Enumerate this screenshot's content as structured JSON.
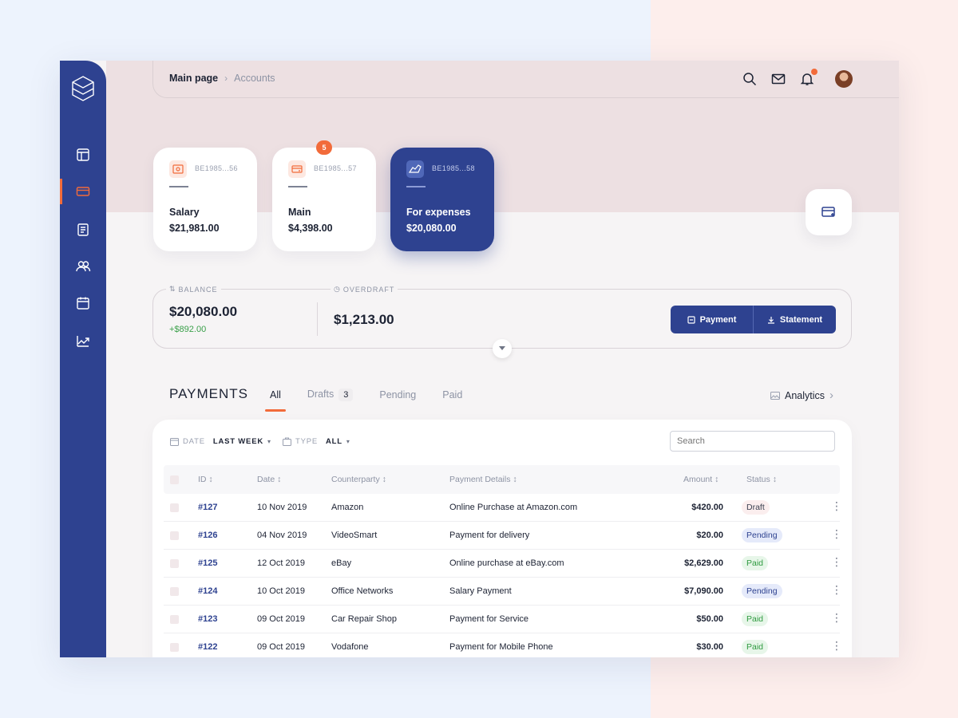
{
  "breadcrumb": {
    "current": "Main page",
    "last": "Accounts"
  },
  "notifications": {
    "has_unread": true
  },
  "accounts": [
    {
      "number": "BE1985...56",
      "name": "Salary",
      "amount": "$21,981.00"
    },
    {
      "number": "BE1985...57",
      "name": "Main",
      "amount": "$4,398.00",
      "badge": "5"
    },
    {
      "number": "BE1985...58",
      "name": "For expenses",
      "amount": "$20,080.00"
    }
  ],
  "balance": {
    "label": "BALANCE",
    "amount": "$20,080.00",
    "change": "+$892.00"
  },
  "overdraft": {
    "label": "OVERDRAFT",
    "amount": "$1,213.00"
  },
  "actions": {
    "payment": "Payment",
    "statement": "Statement"
  },
  "payments": {
    "title": "PAYMENTS",
    "tabs": [
      {
        "label": "All"
      },
      {
        "label": "Drafts",
        "count": "3"
      },
      {
        "label": "Pending"
      },
      {
        "label": "Paid"
      }
    ],
    "analytics": "Analytics"
  },
  "filters": {
    "date_label": "DATE",
    "date_value": "LAST WEEK",
    "type_label": "TYPE",
    "type_value": "ALL",
    "search_placeholder": "Search"
  },
  "table": {
    "columns": [
      "ID",
      "Date",
      "Counterparty",
      "Payment Details",
      "Amount",
      "Status"
    ],
    "rows": [
      {
        "id": "#127",
        "date": "10 Nov 2019",
        "counterparty": "Amazon",
        "details": "Online Purchase at Amazon.com",
        "amount": "$420.00",
        "status": "Draft"
      },
      {
        "id": "#126",
        "date": "04 Nov 2019",
        "counterparty": "VideoSmart",
        "details": "Payment for delivery",
        "amount": "$20.00",
        "status": "Pending"
      },
      {
        "id": "#125",
        "date": "12 Oct 2019",
        "counterparty": "eBay",
        "details": "Online purchase at eBay.com",
        "amount": "$2,629.00",
        "status": "Paid"
      },
      {
        "id": "#124",
        "date": "10 Oct 2019",
        "counterparty": "Office Networks",
        "details": "Salary Payment",
        "amount": "$7,090.00",
        "status": "Pending"
      },
      {
        "id": "#123",
        "date": "09 Oct 2019",
        "counterparty": "Car Repair Shop",
        "details": "Payment for Service",
        "amount": "$50.00",
        "status": "Paid"
      },
      {
        "id": "#122",
        "date": "09 Oct 2019",
        "counterparty": "Vodafone",
        "details": "Payment for Mobile Phone",
        "amount": "$30.00",
        "status": "Paid"
      }
    ]
  },
  "colors": {
    "primary": "#2e4290",
    "accent": "#f26b3a",
    "positive": "#3aa04a"
  },
  "icons": {
    "sidebar": [
      "dashboard-icon",
      "card-icon",
      "document-icon",
      "users-icon",
      "calendar-icon",
      "chart-icon"
    ],
    "top": [
      "search-icon",
      "mail-icon",
      "bell-icon"
    ]
  }
}
